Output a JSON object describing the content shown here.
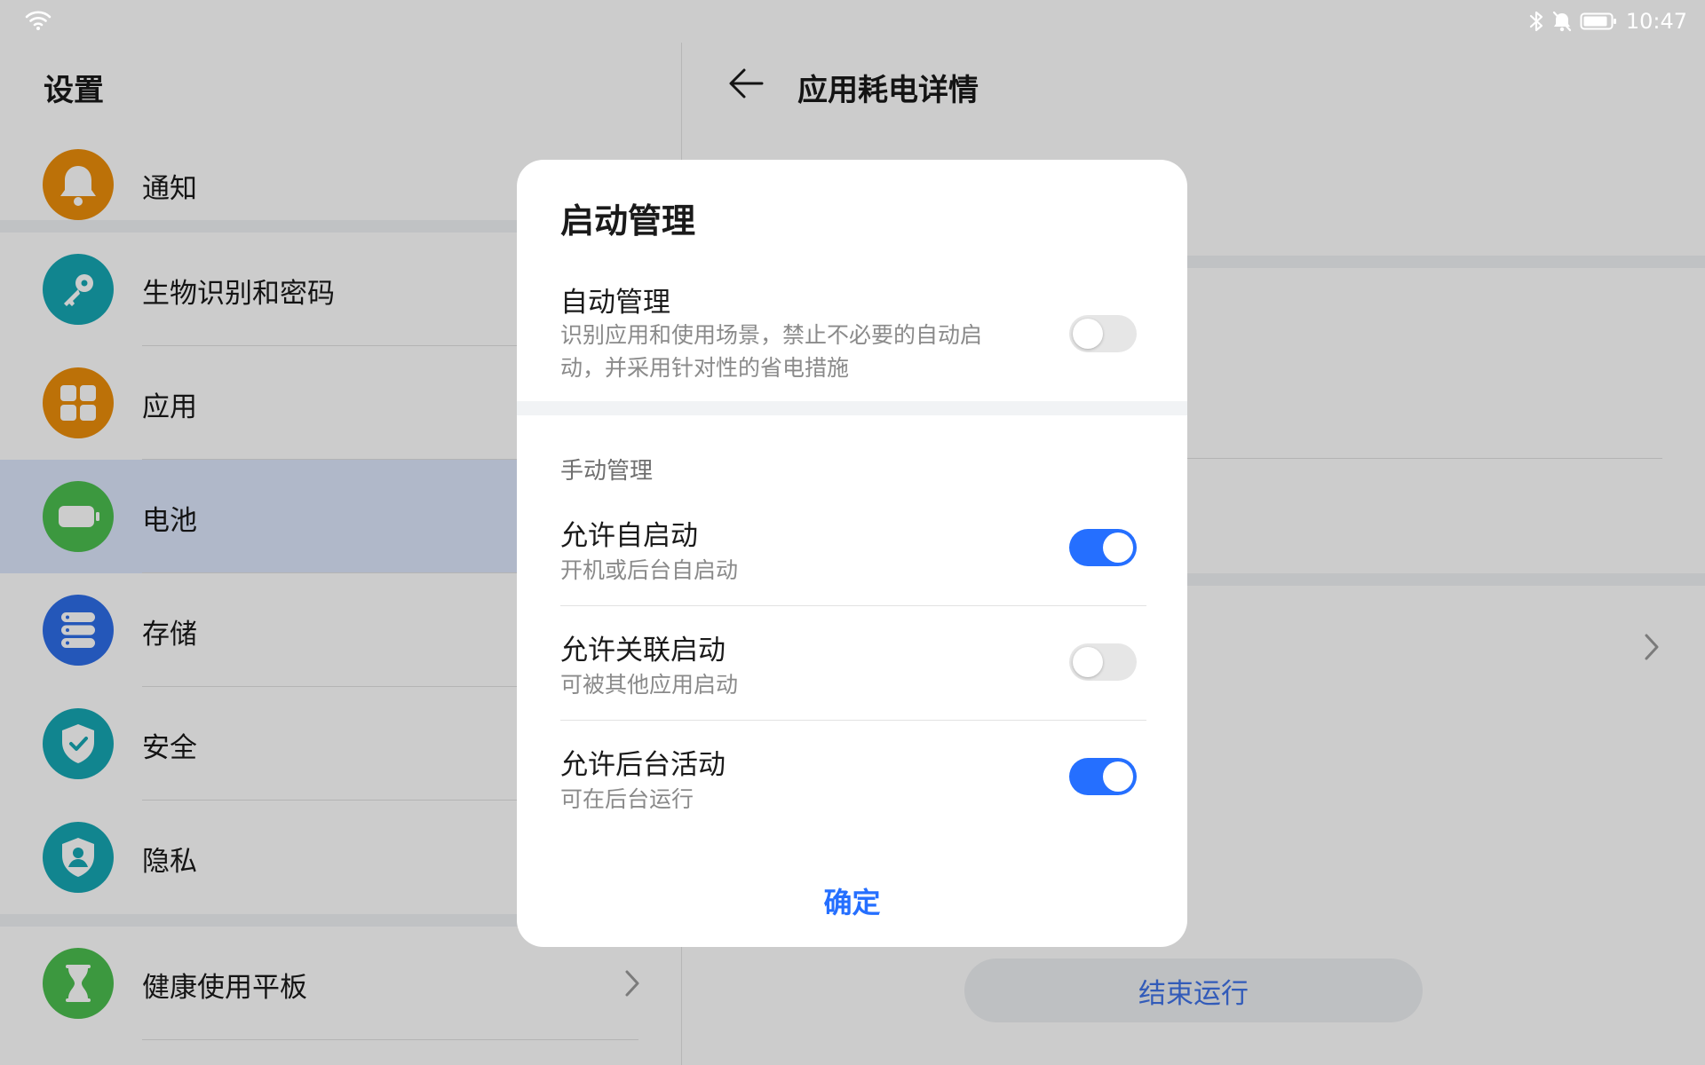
{
  "status_bar": {
    "time": "10:47",
    "icons": [
      "wifi-icon",
      "bluetooth-icon",
      "notifications-off-icon",
      "battery-icon"
    ]
  },
  "settings": {
    "title": "设置",
    "items": [
      {
        "label": "通知",
        "icon": "bell-icon",
        "color": "#ec8e0b"
      },
      {
        "label": "生物识别和密码",
        "icon": "key-icon",
        "color": "#16a7b3"
      },
      {
        "label": "应用",
        "icon": "apps-grid-icon",
        "color": "#ec8e0b"
      },
      {
        "label": "电池",
        "icon": "battery-icon",
        "color": "#4cbe4f",
        "selected": true
      },
      {
        "label": "存储",
        "icon": "storage-icon",
        "color": "#2e6de8"
      },
      {
        "label": "安全",
        "icon": "shield-check-icon",
        "color": "#16a7b3"
      },
      {
        "label": "隐私",
        "icon": "privacy-shield-icon",
        "color": "#16a7b3"
      },
      {
        "label": "健康使用平板",
        "icon": "hourglass-icon",
        "color": "#4cbe4f"
      }
    ]
  },
  "detail": {
    "title": "应用耗电详情",
    "end_button": "结束运行"
  },
  "dialog": {
    "title": "启动管理",
    "auto": {
      "title": "自动管理",
      "desc_line1": "识别应用和使用场景，禁止不必要的自动启",
      "desc_line2": "动，并采用针对性的省电措施",
      "enabled": false
    },
    "manual_header": "手动管理",
    "manual_items": [
      {
        "title": "允许自启动",
        "desc": "开机或后台自启动",
        "enabled": true
      },
      {
        "title": "允许关联启动",
        "desc": "可被其他应用启动",
        "enabled": false
      },
      {
        "title": "允许后台活动",
        "desc": "可在后台运行",
        "enabled": true
      }
    ],
    "confirm": "确定"
  },
  "colors": {
    "accent": "#256fff",
    "selected_row": "#dde6fc",
    "switch_off": "#e6e6e6"
  }
}
